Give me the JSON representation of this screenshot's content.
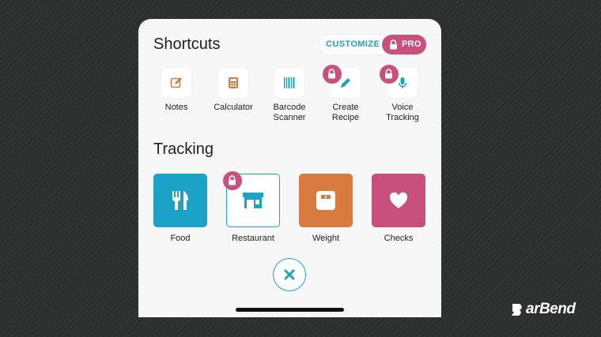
{
  "shortcuts": {
    "title": "Shortcuts",
    "customize_label": "CUSTOMIZE",
    "pro_label": "PRO",
    "items": [
      {
        "label_line1": "Notes",
        "label_line2": "",
        "icon": "note-edit-icon",
        "locked": false
      },
      {
        "label_line1": "Calculator",
        "label_line2": "",
        "icon": "calculator-icon",
        "locked": false
      },
      {
        "label_line1": "Barcode",
        "label_line2": "Scanner",
        "icon": "barcode-icon",
        "locked": false
      },
      {
        "label_line1": "Create",
        "label_line2": "Recipe",
        "icon": "pencil-icon",
        "locked": true
      },
      {
        "label_line1": "Voice",
        "label_line2": "Tracking",
        "icon": "microphone-icon",
        "locked": true
      }
    ]
  },
  "tracking": {
    "title": "Tracking",
    "items": [
      {
        "label": "Food",
        "icon": "fork-knife-icon",
        "color": "#1aa3c6",
        "locked": false
      },
      {
        "label": "Restaurant",
        "icon": "storefront-icon",
        "color": "#ffffff",
        "locked": true
      },
      {
        "label": "Weight",
        "icon": "scale-icon",
        "color": "#d97a3e",
        "locked": false
      },
      {
        "label": "Checks",
        "icon": "heart-icon",
        "color": "#c94f7c",
        "locked": false
      }
    ]
  },
  "colors": {
    "accent": "#1aa3c6",
    "pro": "#c94f7c",
    "weight": "#d97a3e",
    "background": "#2c2d2d"
  },
  "brand": {
    "text": "arBend"
  }
}
